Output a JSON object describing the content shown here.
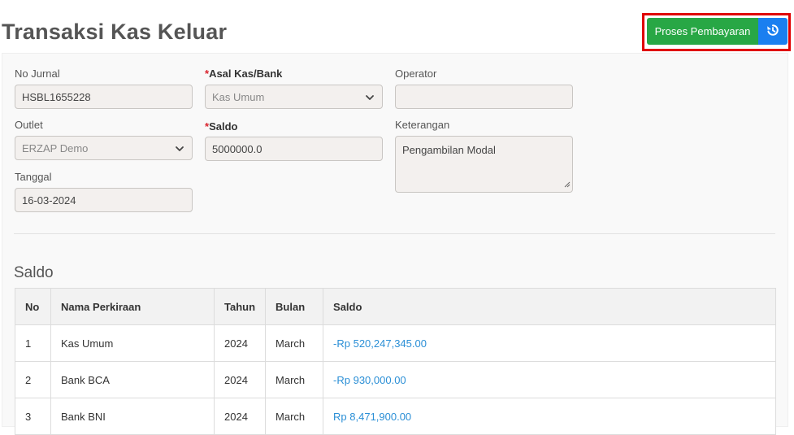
{
  "page": {
    "title": "Transaksi Kas Keluar"
  },
  "actions": {
    "proses_label": "Proses Pembayaran",
    "back_icon": "history-back-icon"
  },
  "form": {
    "no_jurnal": {
      "label": "No Jurnal",
      "value": "HSBL1655228"
    },
    "asal_kas": {
      "required_mark": "*",
      "label": "Asal Kas/Bank",
      "value": "Kas Umum"
    },
    "operator": {
      "label": "Operator",
      "value": ""
    },
    "outlet": {
      "label": "Outlet",
      "value": "ERZAP Demo"
    },
    "saldo": {
      "required_mark": "*",
      "label": "Saldo",
      "value": "5000000.0"
    },
    "keterangan": {
      "label": "Keterangan",
      "value": "Pengambilan Modal"
    },
    "tanggal": {
      "label": "Tanggal",
      "value": "16-03-2024"
    }
  },
  "saldo_section": {
    "title": "Saldo",
    "columns": [
      "No",
      "Nama Perkiraan",
      "Tahun",
      "Bulan",
      "Saldo"
    ],
    "rows": [
      {
        "no": "1",
        "nama": "Kas Umum",
        "tahun": "2024",
        "bulan": "March",
        "saldo": "-Rp 520,247,345.00"
      },
      {
        "no": "2",
        "nama": "Bank BCA",
        "tahun": "2024",
        "bulan": "March",
        "saldo": "-Rp 930,000.00"
      },
      {
        "no": "3",
        "nama": "Bank BNI",
        "tahun": "2024",
        "bulan": "March",
        "saldo": "Rp 8,471,900.00"
      }
    ]
  },
  "colors": {
    "primary_green": "#28a745",
    "primary_blue": "#1a7ff0",
    "highlight_red": "#e00000",
    "money_blue": "#2b8fd6"
  }
}
